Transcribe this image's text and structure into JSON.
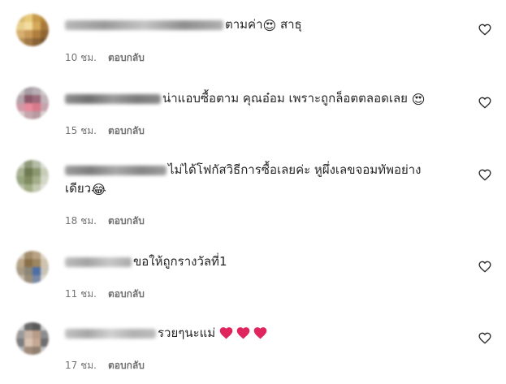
{
  "comments": [
    {
      "id": "c1",
      "text_parts": [
        "ตามค่า",
        "😍",
        " สาธุ"
      ],
      "time": "10 ชม.",
      "reply_label": "ตอบกลับ",
      "like_icon": "heart-outline-icon"
    },
    {
      "id": "c2",
      "text_parts": [
        "น่าแอบซื้อตาม คุณอ๋อม เพราะถูกล็อตตลอดเลย ",
        "😍"
      ],
      "time": "15 ชม.",
      "reply_label": "ตอบกลับ",
      "like_icon": "heart-outline-icon"
    },
    {
      "id": "c3",
      "text_line1": "ไม่ได้โฟกัสวิธีการซื้อเลยค่ะ หูผึ่งเลขจอมทัพอย่าง",
      "text_line2": "เดียว",
      "emoji": "😂",
      "time": "18 ชม.",
      "reply_label": "ตอบกลับ",
      "like_icon": "heart-outline-icon"
    },
    {
      "id": "c4",
      "text": "ขอให้ถูกรางวัลที่1",
      "time": "11 ชม.",
      "reply_label": "ตอบกลับ",
      "like_icon": "heart-outline-icon"
    },
    {
      "id": "c5",
      "text": "รวยๆนะแม่",
      "emoji_hearts": [
        "red-heart-emoji",
        "red-heart-emoji",
        "red-heart-emoji"
      ],
      "time": "17 ชม.",
      "reply_label": "ตอบกลับ",
      "like_icon": "heart-outline-icon"
    }
  ],
  "colors": {
    "text": "#262626",
    "meta": "#737373",
    "heart_red": "#e0245e"
  }
}
